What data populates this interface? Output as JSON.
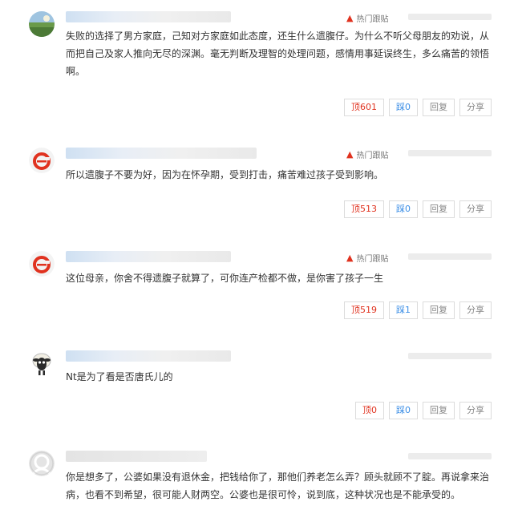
{
  "comments": [
    {
      "hot_label": "热门跟贴",
      "text": "失败的选择了男方家庭，己知对方家庭如此态度，还生什么遗腹仔。为什么不听父母朋友的劝说，从而把自己及家人推向无尽的深渊。毫无判断及理智的处理问题，感情用事延误终生，多么痛苦的领悟啊。",
      "actions": {
        "up": "顶601",
        "down": "踩0",
        "reply": "回复",
        "share": "分享"
      }
    },
    {
      "hot_label": "热门跟贴",
      "text": "所以遗腹子不要为好，因为在怀孕期，受到打击，痛苦难过孩子受到影响。",
      "actions": {
        "up": "顶513",
        "down": "踩0",
        "reply": "回复",
        "share": "分享"
      }
    },
    {
      "hot_label": "热门跟贴",
      "text": "这位母亲，你舍不得遗腹子就算了，可你连产检都不做，是你害了孩子一生",
      "actions": {
        "up": "顶519",
        "down": "踩1",
        "reply": "回复",
        "share": "分享"
      }
    },
    {
      "text": "Nt是为了看是否唐氏儿的",
      "actions": {
        "up": "顶0",
        "down": "踩0",
        "reply": "回复",
        "share": "分享"
      }
    },
    {
      "text": "你是想多了，公婆如果没有退休金，把钱给你了，那他们养老怎么弄？顾头就顾不了腚。再说拿来治病，也看不到希望，很可能人财两空。公婆也是很可怜，说到底，这种状况也是不能承受的。"
    }
  ],
  "icons": {
    "hot": "flame-icon",
    "avatar_1": "landscape-avatar",
    "avatar_2": "netease-logo-avatar",
    "avatar_3": "netease-logo-avatar",
    "avatar_4": "sheep-avatar",
    "avatar_5": "default-user-avatar"
  },
  "colors": {
    "accent_red": "#e0321f",
    "accent_blue": "#3b8ee6",
    "muted_text": "#888888"
  }
}
